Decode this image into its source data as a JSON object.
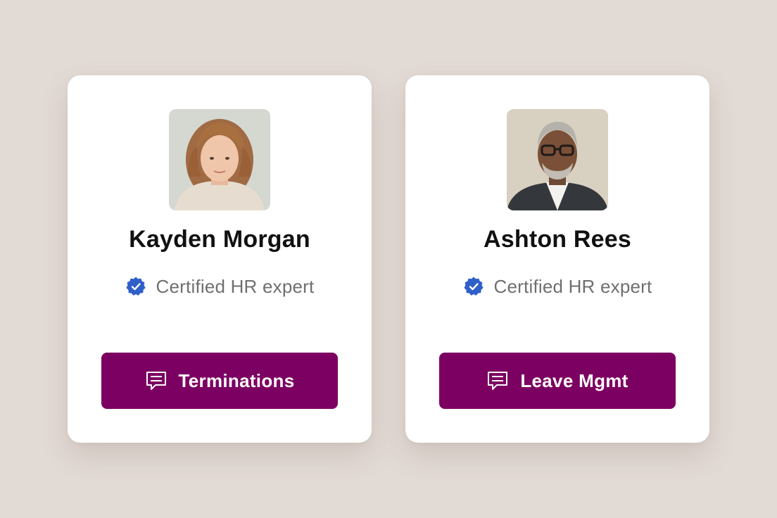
{
  "colors": {
    "background": "#e2dad5",
    "card": "#ffffff",
    "button": "#7c0061",
    "verified_badge": "#2f5fc8",
    "name_text": "#111111",
    "subtitle_text": "#6f6f6f"
  },
  "experts": [
    {
      "name": "Kayden Morgan",
      "certification": "Certified HR expert",
      "certification_icon": "verified-badge-icon",
      "topic_button": {
        "label": "Terminations",
        "icon": "chat-message-icon"
      }
    },
    {
      "name": "Ashton Rees",
      "certification": "Certified HR expert",
      "certification_icon": "verified-badge-icon",
      "topic_button": {
        "label": "Leave Mgmt",
        "icon": "chat-message-icon"
      }
    }
  ]
}
